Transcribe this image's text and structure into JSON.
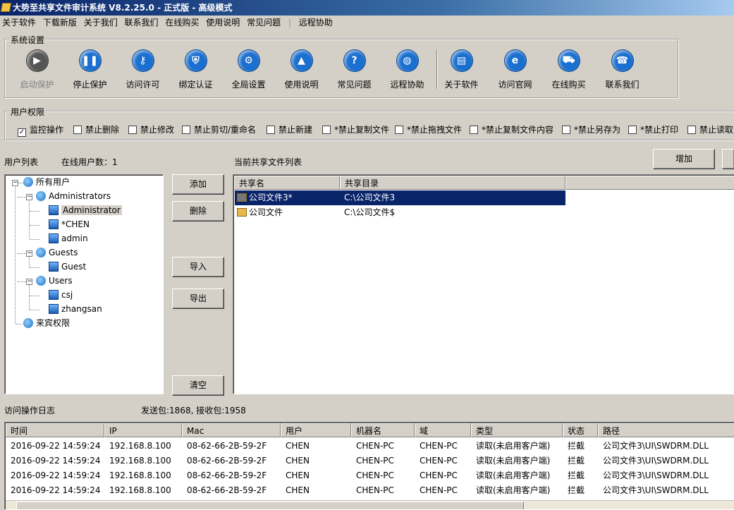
{
  "window": {
    "title": "大势至共享文件审计系统 V8.2.25.0 - 正式版 - 高级模式"
  },
  "menu": [
    "关于软件",
    "下载新版",
    "关于我们",
    "联系我们",
    "在线购买",
    "使用说明",
    "常见问题",
    "远程协助"
  ],
  "system_settings": {
    "label": "系统设置",
    "buttons": [
      {
        "label": "启动保护",
        "icon": "play-icon",
        "color": "#555555",
        "glyph": "▶"
      },
      {
        "label": "停止保护",
        "icon": "pause-icon",
        "color": "#1a6fd0",
        "glyph": "❚❚"
      },
      {
        "label": "访问许可",
        "icon": "key-icon",
        "color": "#1a6fd0",
        "glyph": "⚷"
      },
      {
        "label": "绑定认证",
        "icon": "shield-icon",
        "color": "#1a6fd0",
        "glyph": "⛨"
      },
      {
        "label": "全局设置",
        "icon": "gear-icon",
        "color": "#1a6fd0",
        "glyph": "⚙"
      },
      {
        "label": "使用说明",
        "icon": "graduation-cap-icon",
        "color": "#1a6fd0",
        "glyph": "▲"
      },
      {
        "label": "常见问题",
        "icon": "question-icon",
        "color": "#1a6fd0",
        "glyph": "?"
      },
      {
        "label": "远程协助",
        "icon": "globe-icon",
        "color": "#1a6fd0",
        "glyph": "◍"
      },
      {
        "label": "关于软件",
        "icon": "document-icon",
        "color": "#1a6fd0",
        "glyph": "▤"
      },
      {
        "label": "访问官网",
        "icon": "browser-icon",
        "color": "#1a6fd0",
        "glyph": "e"
      },
      {
        "label": "在线购买",
        "icon": "cart-icon",
        "color": "#1a6fd0",
        "glyph": "⛟"
      },
      {
        "label": "联系我们",
        "icon": "phone-icon",
        "color": "#1a6fd0",
        "glyph": "☎"
      }
    ]
  },
  "user_permissions": {
    "label": "用户权限",
    "options": [
      {
        "label": "监控操作",
        "checked": true
      },
      {
        "label": "禁止删除",
        "checked": false
      },
      {
        "label": "禁止修改",
        "checked": false
      },
      {
        "label": "禁止剪切/重命名",
        "checked": false
      },
      {
        "label": "禁止新建",
        "checked": false
      },
      {
        "label": "*禁止复制文件",
        "checked": false
      },
      {
        "label": "*禁止拖拽文件",
        "checked": false
      },
      {
        "label": "*禁止复制文件内容",
        "checked": false
      },
      {
        "label": "*禁止另存为",
        "checked": false
      },
      {
        "label": "*禁止打印",
        "checked": false
      },
      {
        "label": "禁止读取",
        "checked": false
      }
    ]
  },
  "user_list": {
    "label": "用户列表",
    "online_label": "在线用户数：1",
    "tree": {
      "root": "所有用户",
      "groups": [
        {
          "name": "Administrators",
          "users": [
            "Administrator",
            "*CHEN",
            "admin"
          ],
          "selected_user": "Administrator"
        },
        {
          "name": "Guests",
          "users": [
            "Guest"
          ]
        },
        {
          "name": "Users",
          "users": [
            "csj",
            "zhangsan"
          ]
        }
      ],
      "guest": "来宾权限"
    }
  },
  "middle_buttons": {
    "add": "添加",
    "delete": "删除",
    "import": "导入",
    "export": "导出",
    "clear": "清空"
  },
  "shared_files": {
    "label": "当前共享文件列表",
    "add_button": "增加",
    "columns": [
      "共享名",
      "共享目录"
    ],
    "rows": [
      {
        "name": "公司文件3*",
        "dir": "C:\\公司文件3",
        "selected": true
      },
      {
        "name": "公司文件",
        "dir": "C:\\公司文件$",
        "selected": false
      }
    ]
  },
  "log": {
    "label": "访问操作日志",
    "packets": "发送包:1868, 接收包:1958",
    "columns": [
      "时间",
      "IP",
      "Mac",
      "用户",
      "机器名",
      "域",
      "类型",
      "状态",
      "路径"
    ],
    "rows": [
      [
        "2016-09-22 14:59:24",
        "192.168.8.100",
        "08-62-66-2B-59-2F",
        "CHEN",
        "CHEN-PC",
        "CHEN-PC",
        "读取(未启用客户端)",
        "拦截",
        "公司文件3\\UI\\SWDRM.DLL"
      ],
      [
        "2016-09-22 14:59:24",
        "192.168.8.100",
        "08-62-66-2B-59-2F",
        "CHEN",
        "CHEN-PC",
        "CHEN-PC",
        "读取(未启用客户端)",
        "拦截",
        "公司文件3\\UI\\SWDRM.DLL"
      ],
      [
        "2016-09-22 14:59:24",
        "192.168.8.100",
        "08-62-66-2B-59-2F",
        "CHEN",
        "CHEN-PC",
        "CHEN-PC",
        "读取(未启用客户端)",
        "拦截",
        "公司文件3\\UI\\SWDRM.DLL"
      ],
      [
        "2016-09-22 14:59:24",
        "192.168.8.100",
        "08-62-66-2B-59-2F",
        "CHEN",
        "CHEN-PC",
        "CHEN-PC",
        "读取(未启用客户端)",
        "拦截",
        "公司文件3\\UI\\SWDRM.DLL"
      ]
    ]
  }
}
